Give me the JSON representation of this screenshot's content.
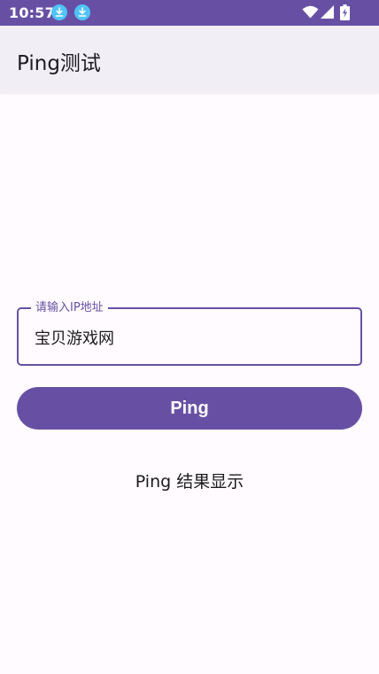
{
  "status_bar": {
    "time": "10:57",
    "bg_color": "#6750a4",
    "notification_icons": [
      "download-icon",
      "download-icon"
    ],
    "system_icons": [
      "wifi-icon",
      "signal-icon",
      "battery-charging-icon"
    ]
  },
  "app_bar": {
    "title": "Ping测试"
  },
  "form": {
    "ip_label": "请输入IP地址",
    "ip_value": "宝贝游戏网",
    "accent_color": "#6750a4"
  },
  "actions": {
    "ping_label": "Ping"
  },
  "result": {
    "text": "Ping 结果显示"
  }
}
